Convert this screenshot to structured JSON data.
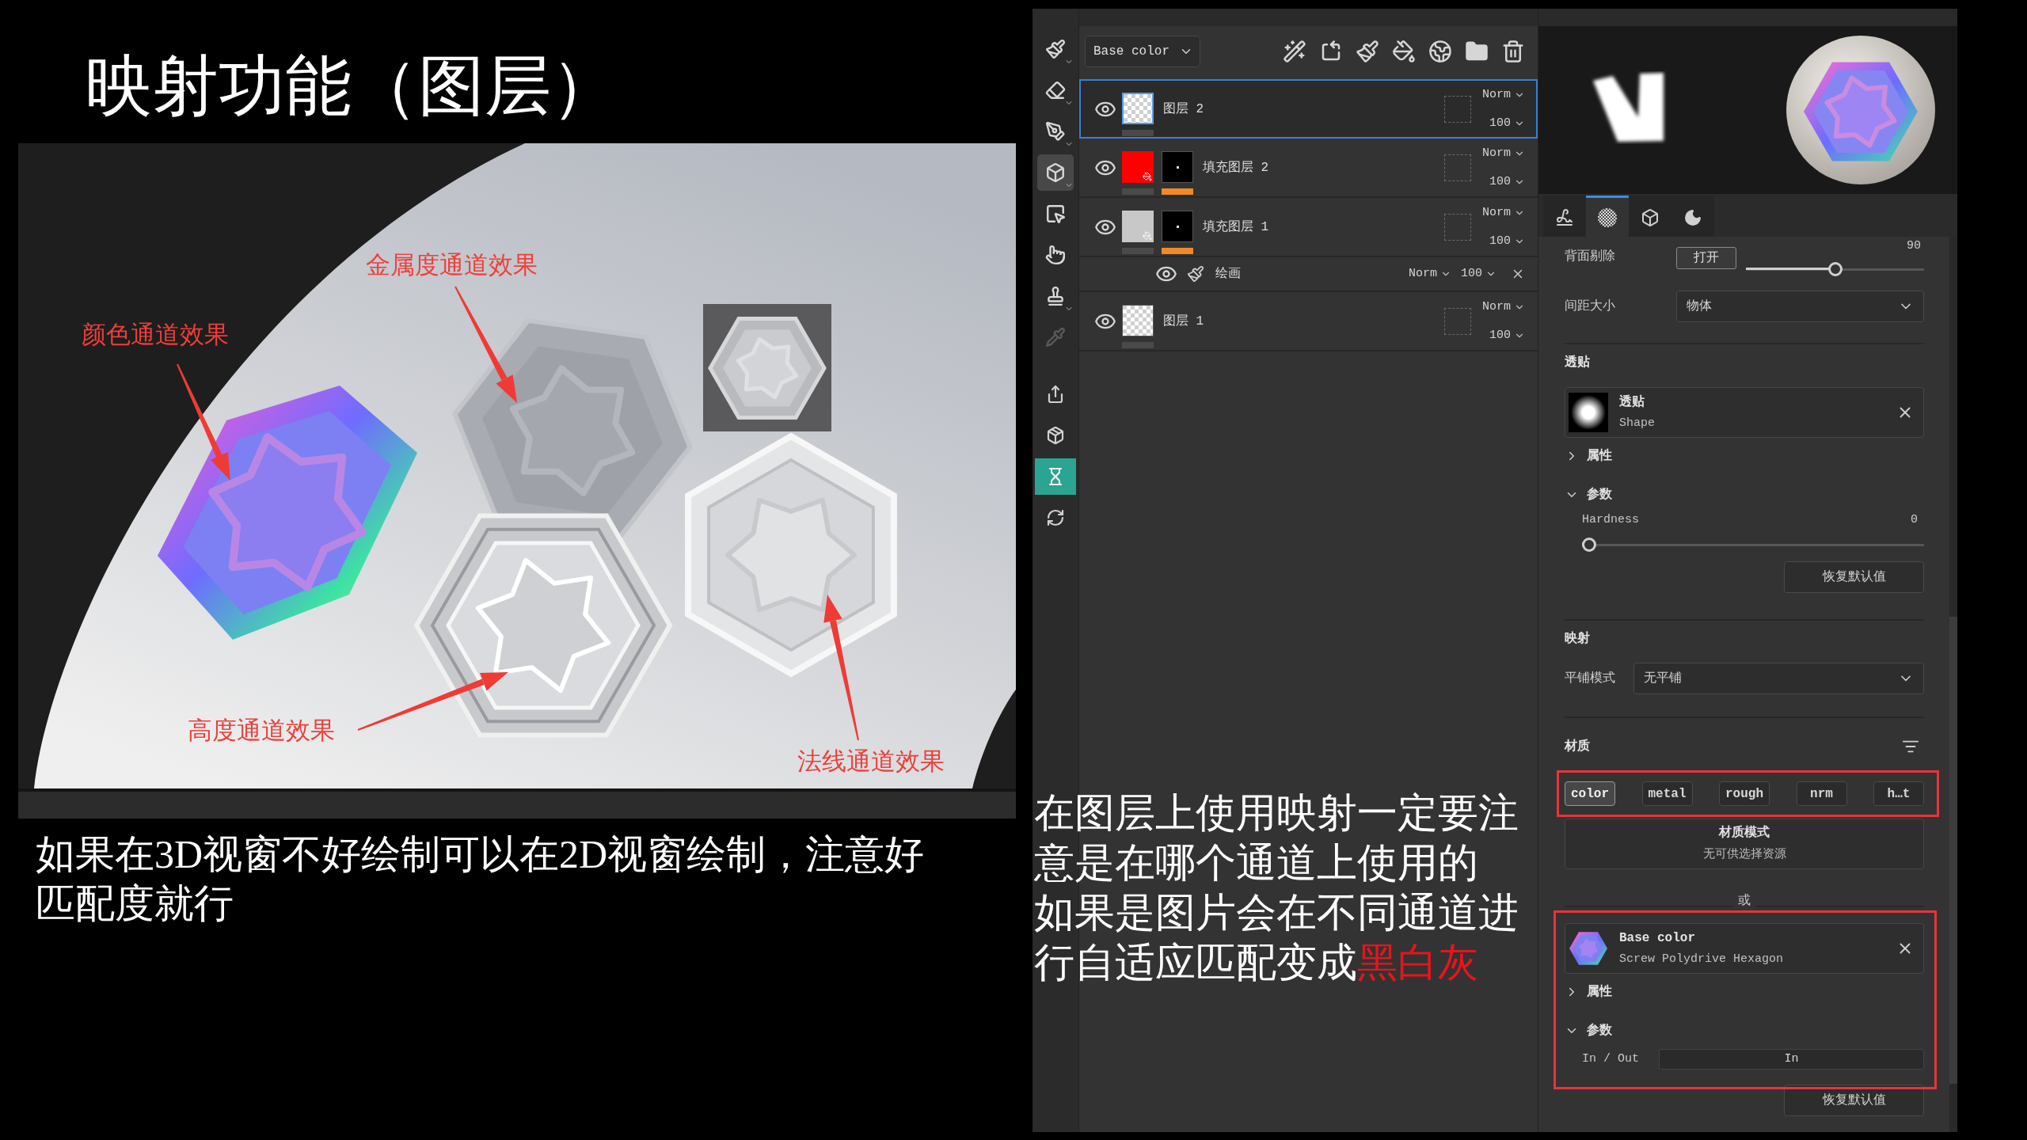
{
  "slide": {
    "title": "映射功能（图层）"
  },
  "render": {
    "annotations": [
      {
        "text": "金属度通道效果"
      },
      {
        "text": "颜色通道效果"
      },
      {
        "text": "高度通道效果"
      },
      {
        "text": "法线通道效果"
      }
    ]
  },
  "caption": "如果在3D视窗不好绘制可以在2D视窗绘制，注意好匹配度就行",
  "notes": {
    "paragraphs": [
      {
        "parts": [
          {
            "text": "在图层上使用映射一定要注意是在哪个通道上使用的",
            "highlighted": false
          }
        ]
      },
      {
        "parts": [
          {
            "text": "如果是图片会在不同通道进行自适应匹配变成",
            "highlighted": false
          },
          {
            "text": "黑白灰",
            "highlighted": true
          }
        ]
      }
    ]
  },
  "app": {
    "toolbar": {
      "tools": [
        {
          "kind": "brush",
          "selected": false,
          "disabled": false
        },
        {
          "kind": "eraser",
          "selected": false,
          "disabled": false
        },
        {
          "kind": "projection",
          "selected": false,
          "disabled": false
        },
        {
          "kind": "geometry",
          "selected": true,
          "disabled": false
        },
        {
          "kind": "polygon",
          "selected": false,
          "disabled": false
        },
        {
          "kind": "smudge",
          "selected": false,
          "disabled": false
        },
        {
          "kind": "clone",
          "selected": false,
          "disabled": false
        },
        {
          "kind": "picker",
          "selected": false,
          "disabled": true
        }
      ],
      "panel_buttons": [
        {
          "kind": "export",
          "on": false
        },
        {
          "kind": "bake",
          "on": false
        },
        {
          "kind": "history",
          "on": true
        },
        {
          "kind": "viewer",
          "on": false
        }
      ]
    },
    "layers": {
      "channel": "Base color",
      "items": [
        {
          "kind": "paint",
          "name": "图层 2",
          "selected": true,
          "visible": true,
          "blend": "Norm",
          "opacity": "100"
        },
        {
          "kind": "fill",
          "name": "填充图层 2",
          "selected": false,
          "visible": true,
          "color": "#ff0000",
          "blend": "Norm",
          "opacity": "100"
        },
        {
          "kind": "fill",
          "name": "填充图层 1",
          "selected": false,
          "visible": true,
          "color": "#c8c8c8",
          "blend": "Norm",
          "opacity": "100",
          "children": [
            {
              "kind": "paint",
              "name": "绘画",
              "visible": true,
              "blend": "Norm",
              "opacity": "100"
            }
          ]
        },
        {
          "kind": "paint",
          "name": "图层 1",
          "selected": false,
          "visible": true,
          "blend": "Norm",
          "opacity": "100"
        }
      ]
    },
    "properties": {
      "tabs": [
        {
          "kind": "stroke",
          "selected": false
        },
        {
          "kind": "alpha",
          "selected": true
        },
        {
          "kind": "material",
          "selected": false
        },
        {
          "kind": "environment",
          "selected": false
        }
      ],
      "backface": {
        "label": "背面剔除",
        "toggle": "打开",
        "reading": "90",
        "level": 0.5
      },
      "spacing": {
        "label": "间距大小",
        "value": "物体"
      },
      "alpha": {
        "title": "透贴",
        "resource": {
          "title": "透贴",
          "subtitle": "Shape"
        },
        "groups": [
          {
            "label": "属性",
            "expanded": false
          },
          {
            "label": "参数",
            "expanded": true,
            "parameter": {
              "label": "Hardness",
              "reading": "0",
              "level": 0
            }
          }
        ],
        "reset": "恢复默认值"
      },
      "mapping": {
        "title": "映射",
        "tiling_label": "平铺模式",
        "tiling_value": "无平铺"
      },
      "material": {
        "title": "材质",
        "channel_bar": {
          "highlighted": true,
          "channels": [
            {
              "label": "color",
              "selected": true
            },
            {
              "label": "metal",
              "selected": false
            },
            {
              "label": "rough",
              "selected": false
            },
            {
              "label": "nrm",
              "selected": false
            },
            {
              "label": "h…t",
              "selected": false
            }
          ]
        },
        "mode": {
          "title": "材质模式",
          "text": "无可供选择资源"
        },
        "separator": "或",
        "resource": {
          "highlighted": true,
          "title": "Base color",
          "subtitle": "Screw Polydrive Hexagon",
          "groups": [
            {
              "label": "属性",
              "expanded": false
            },
            {
              "label": "参数",
              "expanded": true,
              "parameter": {
                "label": "In / Out",
                "value": "In"
              }
            }
          ],
          "reset": "恢复默认值"
        }
      }
    }
  }
}
